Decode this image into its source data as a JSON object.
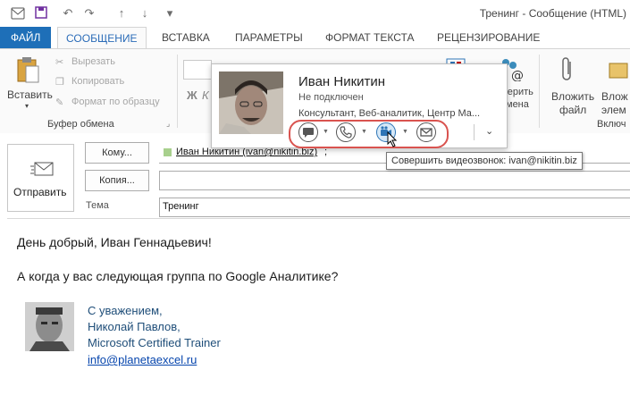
{
  "window": {
    "title": "Тренинг - Сообщение (HTML)"
  },
  "tabs": [
    {
      "label": "ФАЙЛ"
    },
    {
      "label": "СООБЩЕНИЕ"
    },
    {
      "label": "ВСТАВКА"
    },
    {
      "label": "ПАРАМЕТРЫ"
    },
    {
      "label": "ФОРМАТ ТЕКСТА"
    },
    {
      "label": "РЕЦЕНЗИРОВАНИЕ"
    }
  ],
  "ribbon": {
    "paste_label": "Вставить",
    "cut_label": "Вырезать",
    "copy_label": "Копировать",
    "format_painter_label": "Формат по образцу",
    "clipboard_caption": "Буфер обмена",
    "bold_glyph": "Ж",
    "italic_glyph": "К",
    "attach_file_label_1": "Вложить",
    "attach_file_label_2": "файл",
    "attach_item_label_1": "Влож",
    "attach_item_label_2": "элем",
    "include_caption": "Включ",
    "verify_label_1": "верить",
    "verify_label_2": "мена"
  },
  "compose": {
    "send_label": "Отправить",
    "to_button": "Кому...",
    "cc_button": "Копия...",
    "subject_label": "Тема",
    "to_value": "Иван Никитин (ivan@nikitin.biz)",
    "to_suffix": ";",
    "subject_value": "Тренинг"
  },
  "body": {
    "greeting": "День добрый, Иван Геннадьевич!",
    "question": "А когда у вас следующая группа по Google Аналитике?",
    "sig_line1": "С уважением,",
    "sig_line2": "Николай Павлов,",
    "sig_line3": "Microsoft Certified Trainer",
    "sig_email": "info@planetaexcel.ru"
  },
  "contact_card": {
    "name": "Иван Никитин",
    "status": "Не подключен",
    "title": "Консультант, Веб-аналитик, Центр Ма..."
  },
  "tooltip": {
    "text": "Совершить видеозвонок: ivan@nikitin.biz"
  },
  "colors": {
    "accent": "#1e6fb8",
    "signature": "#1f4e79",
    "highlight_circle": "#d9534f",
    "presence": "#a8d08d"
  }
}
